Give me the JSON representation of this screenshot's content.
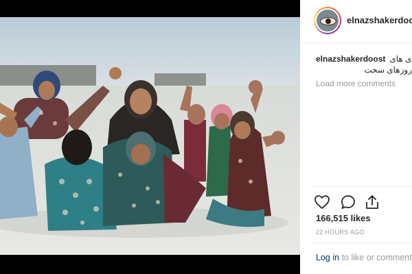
{
  "post": {
    "username": "elnazshakerdoost",
    "caption_user": "elnazshakerdoost",
    "caption_fragment": "ی های",
    "caption_line2": "روزهای سخت",
    "load_more": "Load more comments",
    "likes": "166,515 likes",
    "timestamp": "22 HOURS AGO",
    "login_link": "Log in",
    "comment_prompt": "to like or comment."
  },
  "colors": {
    "text_primary": "#262626",
    "text_muted": "#999999",
    "link": "#003569",
    "background": "#000000"
  },
  "icons": [
    "heart-icon",
    "comment-icon",
    "share-icon"
  ]
}
